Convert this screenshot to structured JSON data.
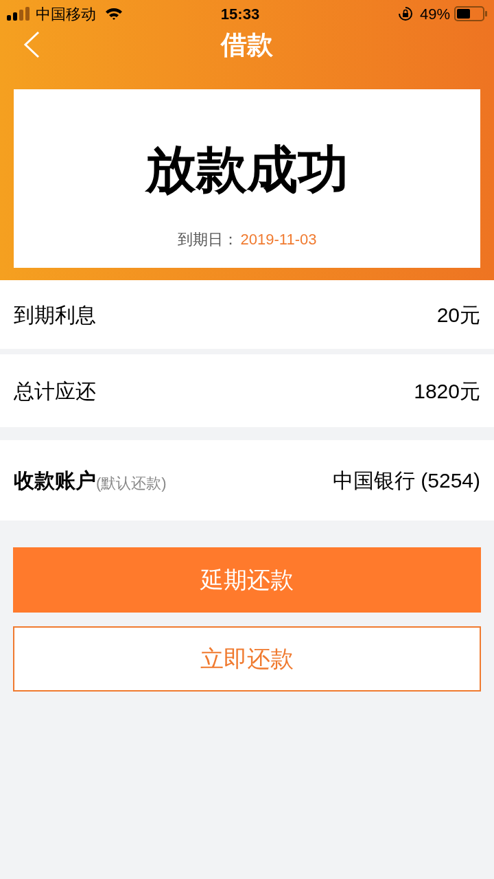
{
  "status_bar": {
    "carrier": "中国移动",
    "time": "15:33",
    "battery": "49%"
  },
  "nav": {
    "title": "借款"
  },
  "result": {
    "title": "放款成功",
    "due_label": "到期日：",
    "due_date": "2019-11-03"
  },
  "rows": [
    {
      "label": "到期利息",
      "value": "20元",
      "bold": false
    },
    {
      "label": "总计应还",
      "value": "1820元",
      "bold": false
    },
    {
      "label": "收款账户",
      "note": "(默认还款)",
      "value": "中国银行 (5254)",
      "bold": true
    }
  ],
  "buttons": [
    {
      "label": "延期还款",
      "kind": "primary"
    },
    {
      "label": "立即还款",
      "kind": "outline"
    }
  ]
}
